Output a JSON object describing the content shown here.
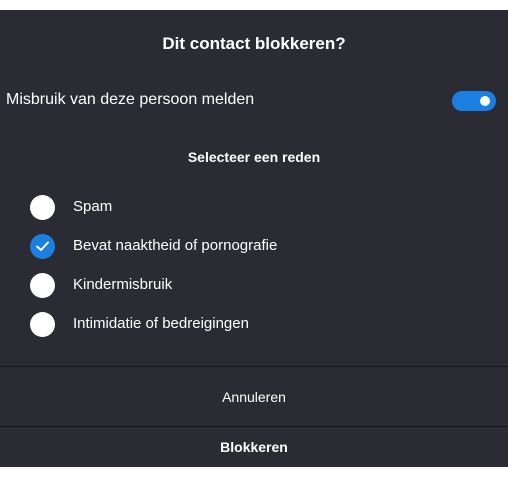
{
  "dialog": {
    "title": "Dit contact blokkeren?",
    "report_label": "Misbruik van deze persoon melden",
    "report_enabled": true,
    "reason_heading": "Selecteer een reden",
    "reasons": [
      {
        "label": "Spam",
        "selected": false
      },
      {
        "label": "Bevat naaktheid of pornografie",
        "selected": true
      },
      {
        "label": "Kindermisbruik",
        "selected": false
      },
      {
        "label": "Intimidatie of bedreigingen",
        "selected": false
      }
    ],
    "cancel_label": "Annuleren",
    "block_label": "Blokkeren"
  },
  "colors": {
    "background": "#2b2b33",
    "accent": "#1a7fe0",
    "divider": "#15151a"
  },
  "icons": {
    "selected_radio": "checkmark-icon",
    "toggle": "toggle-switch"
  }
}
